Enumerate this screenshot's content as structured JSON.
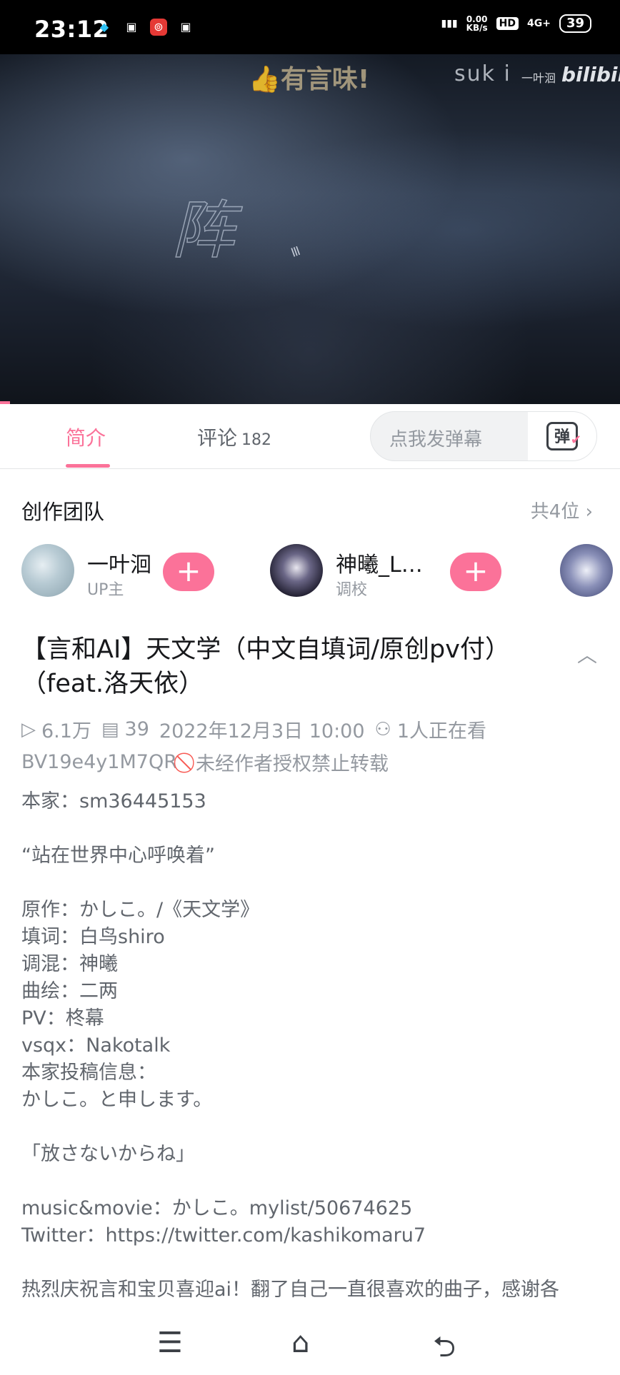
{
  "status_bar": {
    "time": "23:12",
    "left_icons": [
      "qq-icon",
      "bilibili-tv-icon",
      "netease-music-icon",
      "bilibili-tv-icon"
    ],
    "network_speed_value": "0.00",
    "network_speed_unit": "KB/s",
    "hd_label": "HD",
    "signal_label": "4G+",
    "battery_level": "39"
  },
  "video": {
    "watermark_like": "有言味!",
    "watermark_suki": "suk i",
    "watermark_author": "一叶洄",
    "watermark_brand": "bilibili",
    "overlay_char": "阵",
    "progress_fraction": 0.016
  },
  "tabs": {
    "intro_label": "简介",
    "comments_label": "评论",
    "comments_count": "182",
    "danmaku_placeholder": "点我发弹幕",
    "danmaku_icon_text": "弹"
  },
  "team": {
    "title": "创作团队",
    "count_label": "共4位",
    "members": [
      {
        "name": "一叶洄",
        "role": "UP主"
      },
      {
        "name": "神曦_L…",
        "role": "调校"
      }
    ]
  },
  "video_info": {
    "title": "【言和AI】天文学（中文自填词/原创pv付）（feat.洛天依）",
    "views": "6.1万",
    "danmaku_count": "39",
    "publish_time": "2022年12月3日 10:00",
    "watching": "1人正在看",
    "bvid": "BV19e4y1M7QR",
    "repost_notice": "未经作者授权禁止转载"
  },
  "description": {
    "lines": [
      "本家：sm36445153",
      "",
      "“站在世界中心呼唤着”",
      "",
      "原作：かしこ。/《天文学》",
      "填词：白鸟shiro",
      "调混：神曦",
      "曲绘：二两",
      "PV：柊幕",
      "vsqx：Nakotalk",
      "本家投稿信息：",
      "かしこ。と申します。",
      "",
      "「放さないからね」",
      "",
      "music&movie：かしこ。mylist/50674625",
      "Twitter：https://twitter.com/kashikomaru7",
      "",
      "热烈庆祝言和宝贝喜迎ai！翻了自己一直很喜欢的曲子，感谢各"
    ]
  },
  "nav_bar": {
    "icons": [
      "menu-icon",
      "home-icon",
      "back-icon"
    ]
  },
  "colors": {
    "accent": "#fb7299",
    "forbid": "#f85a54",
    "muted": "#9499a0"
  }
}
